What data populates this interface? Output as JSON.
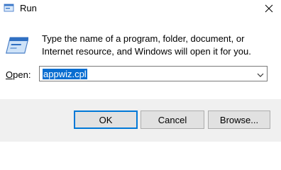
{
  "window": {
    "title": "Run"
  },
  "description": "Type the name of a program, folder, document, or Internet resource, and Windows will open it for you.",
  "open": {
    "label": "Open:",
    "value": "appwiz.cpl"
  },
  "buttons": {
    "ok": "OK",
    "cancel": "Cancel",
    "browse": "Browse..."
  },
  "icons": {
    "app": "run-icon",
    "close": "close-icon",
    "dropdown": "chevron-down-icon"
  },
  "colors": {
    "selection": "#0a6ed1",
    "default_button_border": "#0078d7",
    "footer": "#f0f0f0"
  }
}
